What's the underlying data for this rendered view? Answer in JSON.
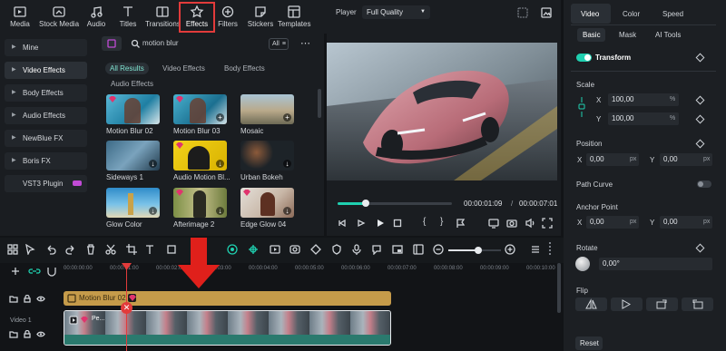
{
  "toolbar": {
    "tabs": [
      {
        "label": "Media",
        "icon": "media-icon"
      },
      {
        "label": "Stock Media",
        "icon": "stock-media-icon"
      },
      {
        "label": "Audio",
        "icon": "audio-icon"
      },
      {
        "label": "Titles",
        "icon": "titles-icon"
      },
      {
        "label": "Transitions",
        "icon": "transitions-icon"
      },
      {
        "label": "Effects",
        "icon": "effects-icon"
      },
      {
        "label": "Filters",
        "icon": "filters-icon"
      },
      {
        "label": "Stickers",
        "icon": "stickers-icon"
      },
      {
        "label": "Templates",
        "icon": "templates-icon"
      }
    ],
    "active": "Effects"
  },
  "categories": [
    "Mine",
    "Video Effects",
    "Body Effects",
    "Audio Effects",
    "NewBlue FX",
    "Boris FX",
    "VST3 Plugin"
  ],
  "search": {
    "value": "motion blur",
    "filter_label": "All"
  },
  "filters": [
    "All Results",
    "Video Effects",
    "Body Effects",
    "Audio Effects"
  ],
  "effects": [
    {
      "label": "Motion Blur 02"
    },
    {
      "label": "Motion Blur 03"
    },
    {
      "label": "Mosaic"
    },
    {
      "label": "Sideways 1"
    },
    {
      "label": "Audio Motion Bl..."
    },
    {
      "label": "Urban Bokeh"
    },
    {
      "label": "Glow Color"
    },
    {
      "label": "Afterimage 2"
    },
    {
      "label": "Edge Glow 04"
    }
  ],
  "player": {
    "label": "Player",
    "quality": "Full Quality",
    "current_time": "00:00:01:09",
    "total_time": "00:00:07:01",
    "progress": 0.08
  },
  "props": {
    "tabs": [
      "Video",
      "Color",
      "Speed"
    ],
    "subtabs": [
      "Basic",
      "Mask",
      "AI Tools"
    ],
    "transform": "Transform",
    "scale": {
      "label": "Scale",
      "x": "100,00",
      "y": "100,00",
      "unit": "%"
    },
    "position": {
      "label": "Position",
      "x": "0,00",
      "y": "0,00",
      "unit": "px"
    },
    "path_curve": "Path Curve",
    "anchor": {
      "label": "Anchor Point",
      "x": "0,00",
      "y": "0,00",
      "unit": "px"
    },
    "rotate": {
      "label": "Rotate",
      "value": "0,00°"
    },
    "flip": "Flip",
    "reset": "Reset",
    "x": "X",
    "y": "Y"
  },
  "timeline": {
    "ticks": [
      "00:00:00:00",
      "00:00:01:00",
      "00:00:02:00",
      "00:00:03:00",
      "00:00:04:00",
      "00:00:05:00",
      "00:00:06:00",
      "00:00:07:00",
      "00:00:08:00",
      "00:00:09:00",
      "00:00:10:00"
    ],
    "effect_clip": "Motion Blur 02",
    "track_label": "Video 1",
    "video_clip": "Pe..."
  },
  "colors": {
    "accent": "#1fd0b0",
    "highlight": "#e23b3b",
    "effect_clip": "#c59b4a",
    "playhead": "#e23b3b"
  }
}
